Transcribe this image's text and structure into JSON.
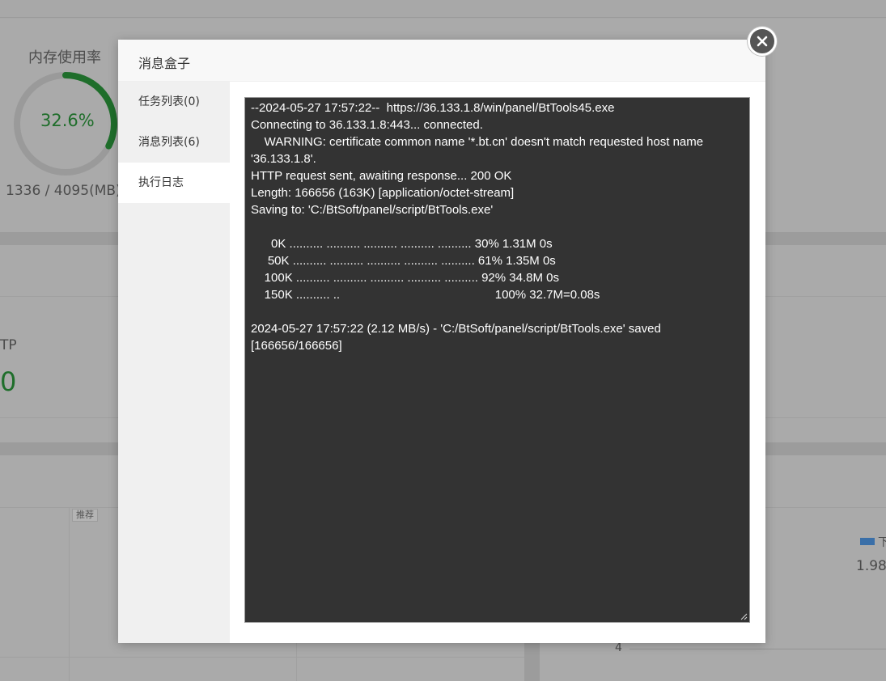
{
  "background": {
    "memory_title": "内存使用率",
    "memory_percent": "32.6%",
    "memory_percent_value": 32.6,
    "memory_detail": "1336 / 4095(MB)",
    "tp_label": "TP",
    "tp_value": "0",
    "recommend_tag": "推荐",
    "legend_label": "下",
    "right_value": "1.98",
    "axis_tick": "4"
  },
  "modal": {
    "title": "消息盒子",
    "close_icon": "close-icon",
    "tabs": [
      {
        "label": "任务列表(0)",
        "active": false
      },
      {
        "label": "消息列表(6)",
        "active": false
      },
      {
        "label": "执行日志",
        "active": true
      }
    ],
    "log": "--2024-05-27 17:57:22--  https://36.133.1.8/win/panel/BtTools45.exe\nConnecting to 36.133.1.8:443... connected.\n    WARNING: certificate common name '*.bt.cn' doesn't match requested host name '36.133.1.8'.\nHTTP request sent, awaiting response... 200 OK\nLength: 166656 (163K) [application/octet-stream]\nSaving to: 'C:/BtSoft/panel/script/BtTools.exe'\n\n      0K .......... .......... .......... .......... .......... 30% 1.31M 0s\n     50K .......... .......... .......... .......... .......... 61% 1.35M 0s\n    100K .......... .......... .......... .......... .......... 92% 34.8M 0s\n    150K .......... ..                                              100% 32.7M=0.08s\n\n2024-05-27 17:57:22 (2.12 MB/s) - 'C:/BtSoft/panel/script/BtTools.exe' saved [166656/166656]"
  },
  "colors": {
    "overlay_bg": "#a7a7a7",
    "gauge_fill": "#1f6e2b",
    "log_bg": "#333333",
    "log_text": "#ffffff"
  }
}
